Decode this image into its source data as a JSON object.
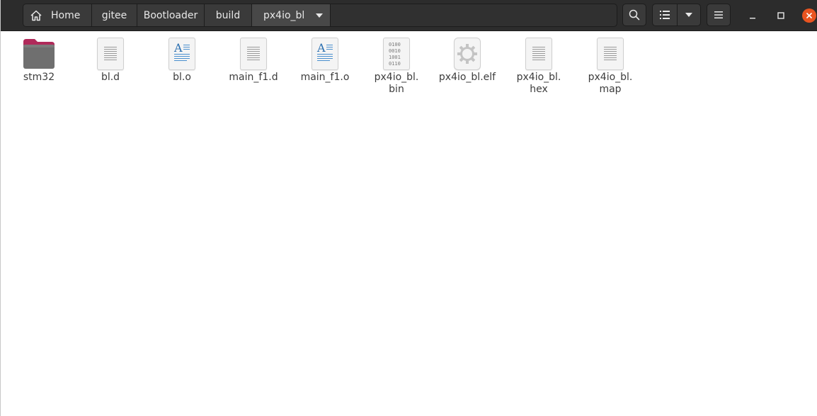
{
  "pathbar": {
    "crumbs": [
      "Home",
      "gitee",
      "Bootloader",
      "build"
    ],
    "current": "px4io_bl"
  },
  "toolbar": {
    "search_icon": "search-icon",
    "view_icon": "list-view-icon",
    "view_options_icon": "chevron-down-icon",
    "menu_icon": "hamburger-menu-icon"
  },
  "window_controls": {
    "close_color": "#e95420",
    "icons": [
      "minimize-icon",
      "maximize-icon",
      "close-icon"
    ]
  },
  "files": [
    {
      "name": "stm32",
      "type": "folder",
      "icon": "folder-icon"
    },
    {
      "name": "bl.d",
      "type": "text",
      "icon": "text-file-icon"
    },
    {
      "name": "bl.o",
      "type": "object",
      "icon": "object-file-icon"
    },
    {
      "name": "main_f1.d",
      "type": "text",
      "icon": "text-file-icon"
    },
    {
      "name": "main_f1.o",
      "type": "object",
      "icon": "object-file-icon"
    },
    {
      "name": "px4io_bl.\nbin",
      "type": "binary",
      "icon": "binary-file-icon"
    },
    {
      "name": "px4io_bl.elf",
      "type": "executable",
      "icon": "executable-gear-icon"
    },
    {
      "name": "px4io_bl.\nhex",
      "type": "text",
      "icon": "text-file-icon"
    },
    {
      "name": "px4io_bl.\nmap",
      "type": "text",
      "icon": "text-file-icon"
    }
  ],
  "binary_glyphs": [
    "0100",
    "0010",
    "1001",
    "0110"
  ],
  "object_glyph": "A"
}
